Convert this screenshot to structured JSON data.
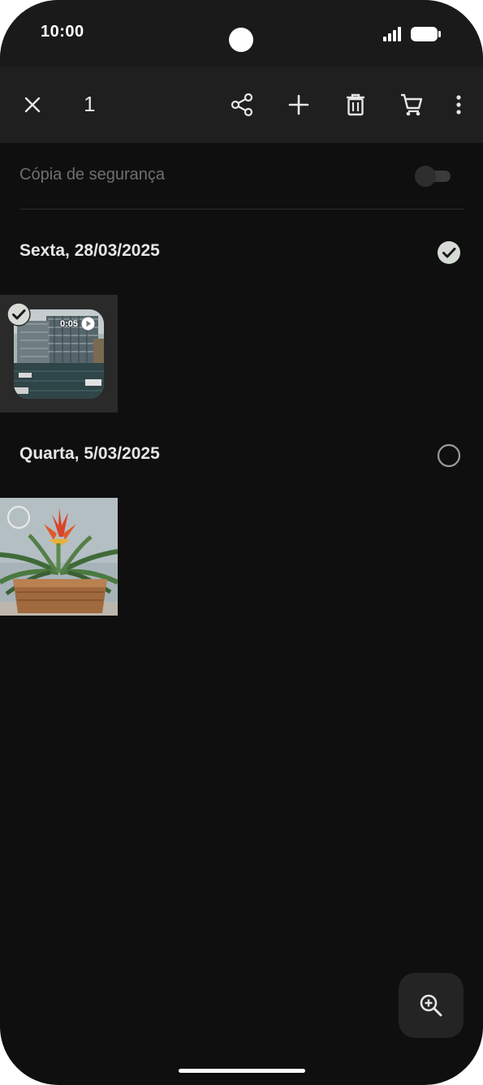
{
  "status_bar": {
    "time": "10:00",
    "icons": [
      "signal-icon",
      "battery-icon"
    ]
  },
  "app_bar": {
    "selected_count": "1",
    "actions": [
      "close-icon",
      "share-icon",
      "add-icon",
      "delete-icon",
      "cart-icon",
      "more-vert-icon"
    ]
  },
  "backup": {
    "label": "Cópia de segurança",
    "enabled": false
  },
  "groups": [
    {
      "date": "Sexta, 28/03/2025",
      "all_selected": true,
      "items": [
        {
          "kind": "video",
          "duration": "0:05",
          "selected": true,
          "subject": "building by water"
        }
      ]
    },
    {
      "date": "Quarta, 5/03/2025",
      "all_selected": false,
      "items": [
        {
          "kind": "photo",
          "selected": false,
          "subject": "potted plant"
        }
      ]
    }
  ],
  "fab": {
    "icon": "zoom-in-icon"
  },
  "colors": {
    "background": "#0f0f0f",
    "app_bar": "#1f1f1f",
    "text_primary": "#e6e6e6",
    "text_muted": "#6f6f6f",
    "check_fill": "#d6dbd6"
  }
}
